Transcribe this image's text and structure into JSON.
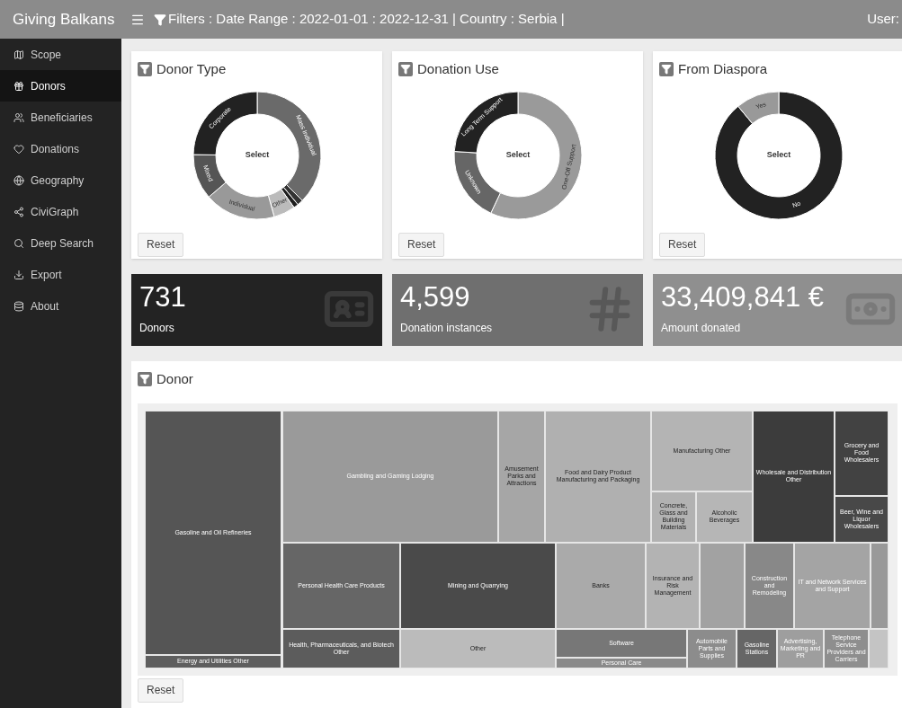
{
  "header": {
    "brand": "Giving Balkans",
    "filters": "Filters : Date Range : 2022-01-01 : 2022-12-31 | Country : Serbia |",
    "user": "User:"
  },
  "sidebar": {
    "items": [
      {
        "label": "Scope",
        "selected": false
      },
      {
        "label": "Donors",
        "selected": true
      },
      {
        "label": "Beneficiaries",
        "selected": false
      },
      {
        "label": "Donations",
        "selected": false
      },
      {
        "label": "Geography",
        "selected": false
      },
      {
        "label": "CiviGraph",
        "selected": false
      },
      {
        "label": "Deep Search",
        "selected": false
      },
      {
        "label": "Export",
        "selected": false
      },
      {
        "label": "About",
        "selected": false
      }
    ]
  },
  "donut_cards": [
    {
      "title": "Donor Type",
      "center": "Select",
      "reset": "Reset",
      "segments": [
        {
          "label": "Mass Individual",
          "color": "#6a6a6a"
        },
        {
          "color": "#333333"
        },
        {
          "color": "#1e1e1e"
        },
        {
          "label": "Other",
          "color": "#bbbbbb"
        },
        {
          "label": "Individual",
          "color": "#999999"
        },
        {
          "label": "Mixed",
          "color": "#555555"
        },
        {
          "label": "Corporate",
          "color": "#222222"
        }
      ]
    },
    {
      "title": "Donation Use",
      "center": "Select",
      "reset": "Reset",
      "segments": [
        {
          "label": "One-Off Support",
          "color": "#9a9a9a"
        },
        {
          "label": "Unknown",
          "color": "#666666"
        },
        {
          "label": "Long Term Support",
          "color": "#222222"
        }
      ]
    },
    {
      "title": "From Diaspora",
      "center": "Select",
      "reset": "Reset",
      "segments": [
        {
          "label": "No",
          "color": "#222222"
        },
        {
          "label": "Yes",
          "color": "#999999"
        }
      ]
    }
  ],
  "stats": [
    {
      "value": "731",
      "label": "Donors"
    },
    {
      "value": "4,599",
      "label": "Donation instances"
    },
    {
      "value": "33,409,841 €",
      "label": "Amount donated"
    }
  ],
  "donor_panel": {
    "title": "Donor",
    "reset": "Reset",
    "tiles": [
      {
        "label": "Gasoline and Oil Refineries",
        "color": "#555555"
      },
      {
        "label": "Energy and Utilities Other",
        "color": "#5e5e5e"
      },
      {
        "label": "Gambling and Gaming Lodging",
        "color": "#9a9a9a"
      },
      {
        "label": "Amusement Parks and Attractions",
        "color": "#a6a6a6"
      },
      {
        "label": "Food and Dairy Product Manufacturing and Packaging",
        "color": "#b0b0b0"
      },
      {
        "label": "Manufacturing Other",
        "color": "#b4b4b4"
      },
      {
        "label": "Concrete, Glass and Building Materials",
        "color": "#b2b2b2"
      },
      {
        "label": "Alcoholic Beverages",
        "color": "#b6b6b6"
      },
      {
        "label": "Wholesale and Distribution Other",
        "color": "#3c3c3c"
      },
      {
        "label": "Grocery and Food Wholesalers",
        "color": "#424242"
      },
      {
        "label": "Beer, Wine and Liquor Wholesalers",
        "color": "#484848"
      },
      {
        "label": "Personal Health Care Products",
        "color": "#666666"
      },
      {
        "label": "Health, Pharmaceuticals, and Biotech Other",
        "color": "#5c5c5c"
      },
      {
        "label": "Mining and Quarrying",
        "color": "#4a4a4a"
      },
      {
        "label": "Other",
        "color": "#bbbbbb"
      },
      {
        "label": "Banks",
        "color": "#aaaaaa"
      },
      {
        "label": "Insurance and Risk Management",
        "color": "#b3b3b3"
      },
      {
        "color": "#a2a2a2"
      },
      {
        "label": "Construction and Remodeling",
        "color": "#888888"
      },
      {
        "label": "IT and Network Services and Support",
        "color": "#a4a4a4"
      },
      {
        "color": "#999999"
      },
      {
        "label": "Software",
        "color": "#777777"
      },
      {
        "label": "Personal Care",
        "color": "#8a8a8a"
      },
      {
        "label": "Automobile Parts and Supplies",
        "color": "#8c8c8c"
      },
      {
        "label": "Gasoline Stations",
        "color": "#666666"
      },
      {
        "label": "Advertising, Marketing and PR",
        "color": "#9e9e9e"
      },
      {
        "label": "Telephone Service Providers and Carriers",
        "color": "#8e8e8e"
      },
      {
        "color": "#c4c4c4"
      }
    ]
  }
}
